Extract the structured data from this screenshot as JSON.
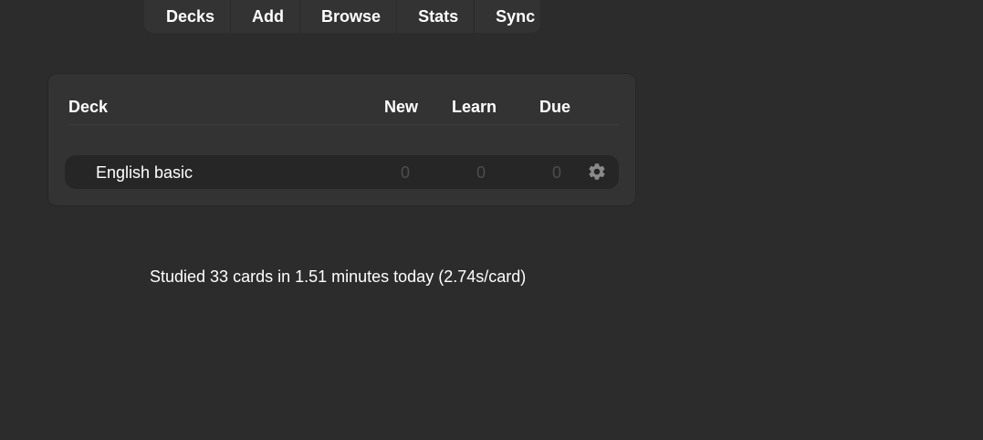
{
  "toolbar": {
    "items": [
      {
        "label": "Decks"
      },
      {
        "label": "Add"
      },
      {
        "label": "Browse"
      },
      {
        "label": "Stats"
      },
      {
        "label": "Sync"
      }
    ]
  },
  "deck_table": {
    "headers": {
      "deck": "Deck",
      "new": "New",
      "learn": "Learn",
      "due": "Due"
    },
    "rows": [
      {
        "name": "English basic",
        "new": "0",
        "learn": "0",
        "due": "0",
        "options_icon": "gear-icon"
      }
    ]
  },
  "stats": {
    "studied_text": "Studied 33 cards in 1.51 minutes today (2.74s/card)"
  },
  "colors": {
    "background": "#2c2c2c",
    "panel": "#333333",
    "row": "#262626",
    "zero_count": "#4d4d4d",
    "gear": "#8a8a8a"
  }
}
